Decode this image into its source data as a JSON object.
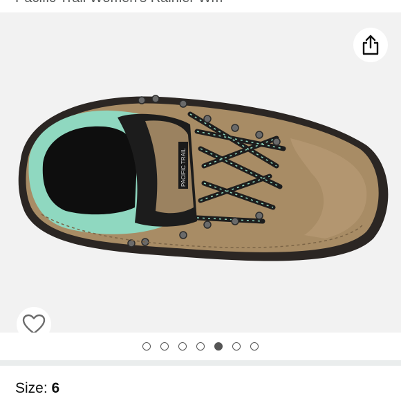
{
  "product": {
    "title": "Pacific Trail Women's Rainier Wm",
    "image_alt": "Pacific Trail women's hiking boot, top view",
    "boot_brand_text": "PACIFIC TRAIL"
  },
  "actions": {
    "share_icon": "share-icon",
    "wishlist_icon": "heart-outline-icon"
  },
  "carousel": {
    "total": 7,
    "active_index": 4
  },
  "size": {
    "label": "Size: ",
    "value": "6"
  },
  "colors": {
    "image_bg": "#f2f2f2",
    "separator": "#eaeded",
    "dot": "#555555"
  }
}
